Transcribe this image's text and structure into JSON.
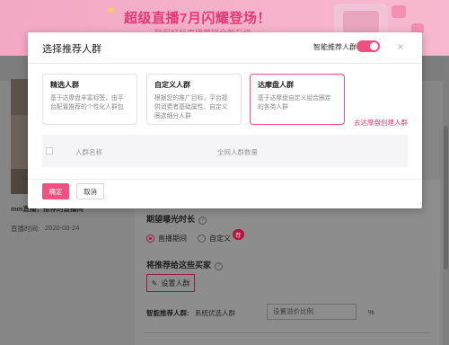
{
  "banner": {
    "title": "超级直播7月闪耀登场！",
    "subtitle": "联保好标直播营销全新升级"
  },
  "background": {
    "product_name": "mm直播，推荐的直播间",
    "live_time_label": "直播时间:",
    "live_time_value": "2020-08-24",
    "exposure_heading": "期望曝光时长",
    "exposure_options": [
      {
        "label": "直播期间",
        "checked": true
      },
      {
        "label": "自定义",
        "checked": false
      }
    ],
    "recommend_badge": "荐",
    "audience_heading": "将推荐给这些买家",
    "set_crowd_button": "设置人群",
    "smart_label": "智能推荐人群:",
    "smart_value": "系统优选人群",
    "ratio_placeholder": "设置溢价比例",
    "ratio_unit": "%"
  },
  "modal": {
    "title": "选择推荐人群",
    "toggle_label": "智能推荐人群",
    "toggle_on": true,
    "close_glyph": "×",
    "cards": [
      {
        "title": "精选人群",
        "desc": "基于达摩盘丰富标签，由平台配置推荐的个性化人群包",
        "selected": false
      },
      {
        "title": "自定义人群",
        "desc": "根据您的推广目标，平台提供消费者基础属性、自定义圈选细分人群",
        "selected": false
      },
      {
        "title": "达摩盘人群",
        "desc": "基于达摩盘自定义组合圈定的各类人群",
        "selected": true
      }
    ],
    "create_link": "去达摩盘创建人群",
    "table_headers": {
      "name": "人群名称",
      "count": "全网人群数量"
    },
    "confirm_button": "确定",
    "cancel_button": "取消"
  },
  "colors": {
    "accent": "#f0507f",
    "link": "#e63c72",
    "banner_text": "#e43a78"
  }
}
